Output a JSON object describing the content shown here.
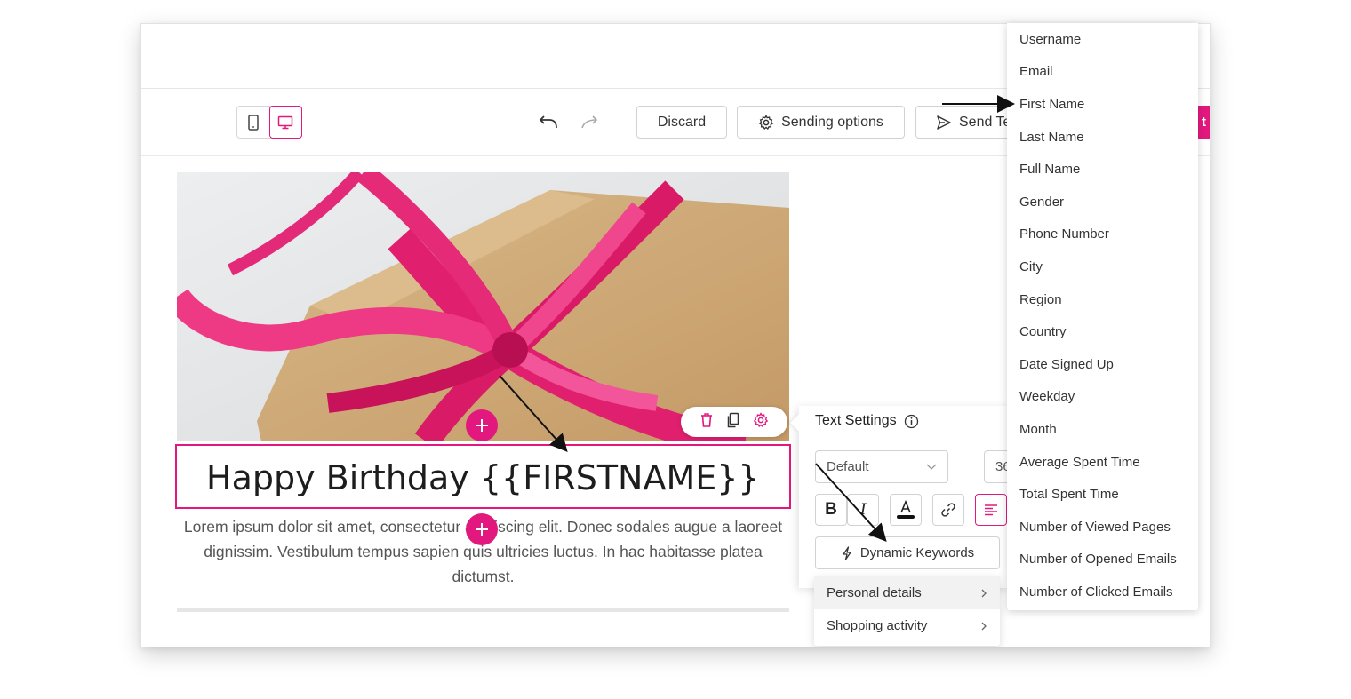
{
  "toolbar": {
    "discard_label": "Discard",
    "sending_options_label": "Sending options",
    "send_test_label": "Send Te",
    "primary_label": "t"
  },
  "editor": {
    "heading": "Happy Birthday {{FIRSTNAME}}",
    "paragraph": "Lorem ipsum dolor sit amet, consectetur adipiscing elit. Donec sodales augue a laoreet dignissim. Vestibulum tempus sapien quis ultricies luctus. In hac habitasse platea dictumst."
  },
  "text_settings": {
    "title": "Text Settings",
    "font_select": "Default",
    "font_size": "36",
    "bold_label": "B",
    "italic_label": "I",
    "dynamic_keywords_label": "Dynamic Keywords"
  },
  "dynamic_menu": {
    "items": [
      {
        "label": "Personal details"
      },
      {
        "label": "Shopping activity"
      }
    ]
  },
  "keywords": {
    "items": [
      {
        "label": "Username"
      },
      {
        "label": "Email"
      },
      {
        "label": "First Name"
      },
      {
        "label": "Last Name"
      },
      {
        "label": "Full Name"
      },
      {
        "label": "Gender"
      },
      {
        "label": "Phone Number"
      },
      {
        "label": "City"
      },
      {
        "label": "Region"
      },
      {
        "label": "Country"
      },
      {
        "label": "Date Signed Up"
      },
      {
        "label": "Weekday"
      },
      {
        "label": "Month"
      },
      {
        "label": "Average Spent Time"
      },
      {
        "label": "Total Spent Time"
      },
      {
        "label": "Number of Viewed Pages"
      },
      {
        "label": "Number of Opened Emails"
      },
      {
        "label": "Number of Clicked Emails"
      }
    ]
  },
  "colors": {
    "accent": "#e3187f"
  }
}
